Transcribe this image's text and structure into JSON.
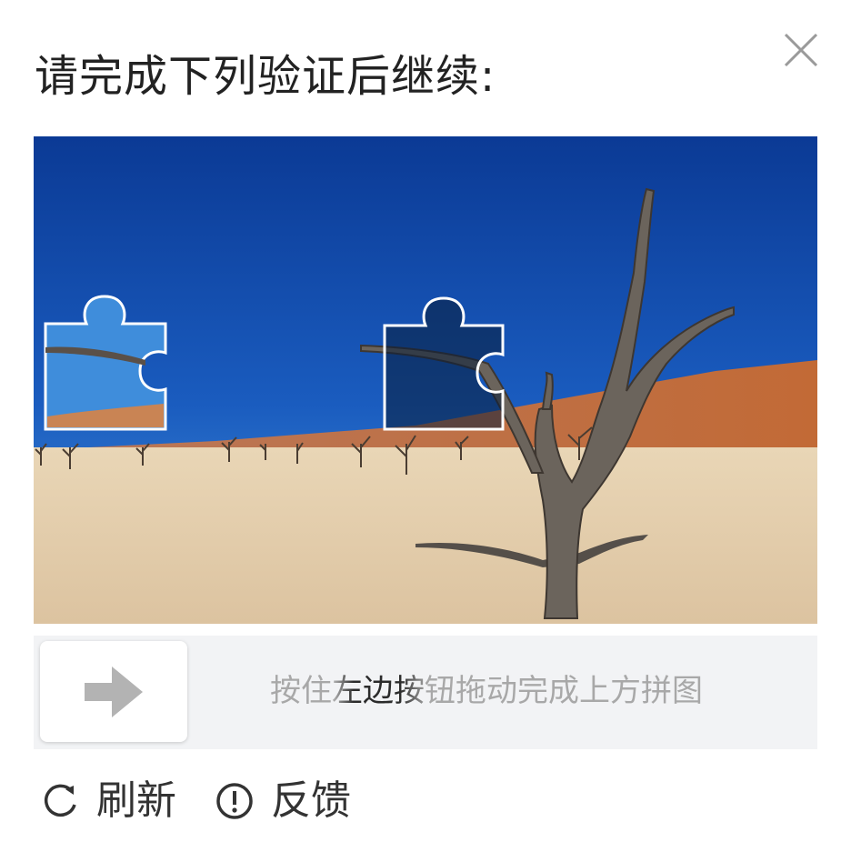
{
  "dialog": {
    "title": "请完成下列验证后继续:",
    "close_icon": "close-icon"
  },
  "captcha": {
    "image_description_icon": "puzzle-background",
    "slider_hint": "按住左边按钮拖动完成上方拼图",
    "slider_icon": "arrow-right-icon"
  },
  "footer": {
    "refresh_label": "刷新",
    "refresh_icon": "refresh-icon",
    "feedback_label": "反馈",
    "feedback_icon": "info-circle-icon"
  },
  "colors": {
    "sky_top": "#0d3e9c",
    "sky_bottom": "#3f8fd8",
    "dune": "#c77a48",
    "sand": "#e7d3b4",
    "track_bg": "#f2f3f5",
    "hint_text": "#a8a8a8"
  }
}
